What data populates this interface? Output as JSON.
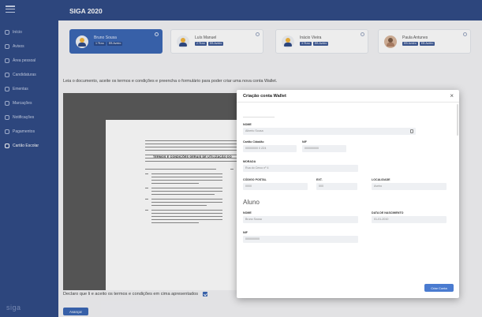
{
  "app": {
    "title": "SIGA 2020",
    "brand": "siga"
  },
  "sidebar": {
    "items": [
      {
        "label": "Início",
        "icon": "home-icon"
      },
      {
        "label": "Avisos",
        "icon": "bell-icon"
      },
      {
        "label": "Área pessoal",
        "icon": "user-icon"
      },
      {
        "label": "Candidaturas",
        "icon": "document-icon"
      },
      {
        "label": "Ementas",
        "icon": "food-icon"
      },
      {
        "label": "Marcações",
        "icon": "calendar-icon"
      },
      {
        "label": "Notificações",
        "icon": "notification-icon"
      },
      {
        "label": "Pagamentos",
        "icon": "payment-icon"
      },
      {
        "label": "Cartão Escolar",
        "icon": "card-icon"
      }
    ]
  },
  "students": [
    {
      "name": "Bruno Sousa",
      "tags": [
        "1.ºAno",
        "EB Aveiro"
      ]
    },
    {
      "name": "Luís Manuel",
      "tags": [
        "2.ºAno",
        "EB Aveiro"
      ]
    },
    {
      "name": "Inácio Vieira",
      "tags": [
        "3.ºAno",
        "EB Aveiro"
      ]
    },
    {
      "name": "Paula Antunes",
      "tags": [
        "EB Aveiro",
        "EB Aveiro"
      ]
    }
  ],
  "main": {
    "instructions": "Leia o documento, aceite os termos e condições e preencha o formulário para poder criar uma nova conta Wallet.",
    "declaration": "Declaro que li e aceito os termos e condições em cima apresentados",
    "next_label": "Avançar",
    "document": {
      "title": "TERMOS E CONDIÇÕES GERAIS DE UTILIZAÇÃO DO"
    }
  },
  "modal": {
    "title": "Criação conta Wallet",
    "close": "×",
    "fields": {
      "name_label": "NOME",
      "name_value": "Alberto Sousa",
      "cc_label": "Cartão Cidadão",
      "cc_value": "00000000 0 ZZ4",
      "nif_label": "NIF",
      "nif_value": "000000000",
      "address_label": "MORADA",
      "address_value": "Rua do Cerco nº 4",
      "postal_label": "CÓDIGO POSTAL",
      "postal_value": "0000",
      "ext_label": "EXT.",
      "ext_value": "000",
      "locality_label": "LOCALIDADE",
      "locality_value": "Aveiro"
    },
    "student_heading": "Aluno",
    "student_fields": {
      "name_label": "NOME",
      "name_value": "Bruno Sousa",
      "birth_label": "DATA DE NASCIMENTO",
      "birth_value": "01-01-2010",
      "nif_label": "NIF",
      "nif_value": "000000000"
    },
    "submit_label": "Criar Conta"
  },
  "colors": {
    "primary": "#2f4a86",
    "accent": "#3a66b5",
    "button": "#4a7bd0"
  }
}
